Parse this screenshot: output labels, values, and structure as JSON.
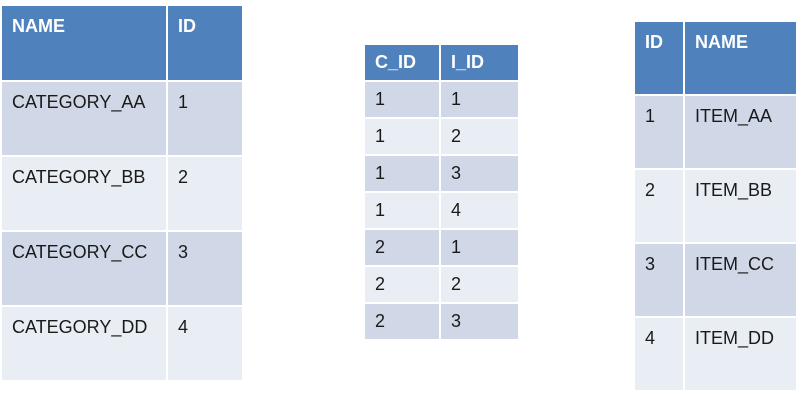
{
  "categories_table": {
    "headers": [
      "NAME",
      "ID"
    ],
    "rows": [
      [
        "CATEGORY_AA",
        "1"
      ],
      [
        "CATEGORY_BB",
        "2"
      ],
      [
        "CATEGORY_CC",
        "3"
      ],
      [
        "CATEGORY_DD",
        "4"
      ]
    ]
  },
  "mapping_table": {
    "headers": [
      "C_ID",
      "I_ID"
    ],
    "rows": [
      [
        "1",
        "1"
      ],
      [
        "1",
        "2"
      ],
      [
        "1",
        "3"
      ],
      [
        "1",
        "4"
      ],
      [
        "2",
        "1"
      ],
      [
        "2",
        "2"
      ],
      [
        "2",
        "3"
      ]
    ]
  },
  "items_table": {
    "headers": [
      "ID",
      "NAME"
    ],
    "rows": [
      [
        "1",
        "ITEM_AA"
      ],
      [
        "2",
        "ITEM_BB"
      ],
      [
        "3",
        "ITEM_CC"
      ],
      [
        "4",
        "ITEM_DD"
      ]
    ]
  },
  "colors": {
    "header_bg": "#4f81bd",
    "row_band_dark": "#d0d8e8",
    "row_band_light": "#e9edf4"
  }
}
